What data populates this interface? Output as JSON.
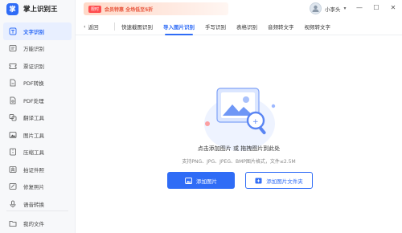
{
  "app": {
    "logo_char": "掌",
    "title": "掌上识别王"
  },
  "banner": {
    "badge": "限时",
    "text": "会员特惠 全场低至5折"
  },
  "user": {
    "name": "小李头"
  },
  "window_controls": [
    "—",
    "☐",
    "✕"
  ],
  "sidebar": {
    "items": [
      {
        "label": "文字识别",
        "icon": "text-scan-icon",
        "active": true
      },
      {
        "label": "万能识别",
        "icon": "universal-scan-icon"
      },
      {
        "label": "票证识别",
        "icon": "ticket-icon"
      },
      {
        "label": "PDF转换",
        "icon": "pdf-convert-icon"
      },
      {
        "label": "PDF处理",
        "icon": "pdf-process-icon"
      },
      {
        "label": "翻译工具",
        "icon": "translate-icon"
      },
      {
        "label": "图片工具",
        "icon": "image-tool-icon"
      },
      {
        "label": "压缩工具",
        "icon": "compress-icon"
      },
      {
        "label": "拍证件照",
        "icon": "id-photo-icon"
      },
      {
        "label": "修复照片",
        "icon": "photo-repair-icon"
      },
      {
        "label": "语音转换",
        "icon": "voice-icon"
      }
    ],
    "bottom": {
      "label": "我的文件",
      "icon": "folder-icon"
    }
  },
  "tabs": {
    "back_label": "返回",
    "items": [
      "快速截图识别",
      "导入图片识别",
      "手写识别",
      "表格识别",
      "音频转文字",
      "视频转文字"
    ],
    "active_index": 1
  },
  "main": {
    "drop_hint": "点击添加图片 或 拖拽图片到此处",
    "formats": "支持PNG、JPG、JPEG、BMP图片格式，文件≤2.5M",
    "add_image_label": "添加图片",
    "add_folder_label": "添加图片文件夹"
  },
  "colors": {
    "accent": "#2f6cf6",
    "sidebar_bg": "#f7f8fa",
    "active_bg": "#e8efff"
  }
}
